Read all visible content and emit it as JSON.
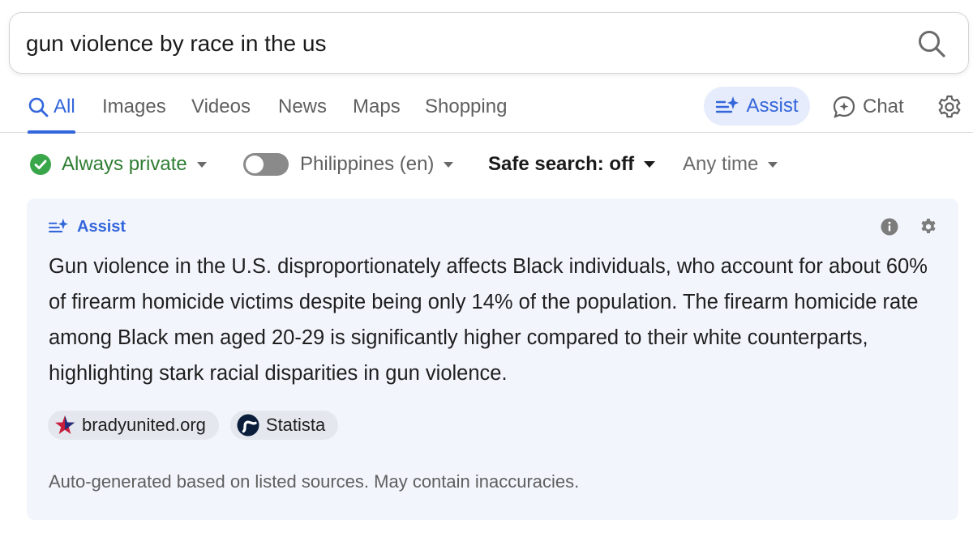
{
  "search": {
    "query": "gun violence by race in the us"
  },
  "tabs": [
    {
      "label": "All"
    },
    {
      "label": "Images"
    },
    {
      "label": "Videos"
    },
    {
      "label": "News"
    },
    {
      "label": "Maps"
    },
    {
      "label": "Shopping"
    }
  ],
  "assist_tab": {
    "label": "Assist"
  },
  "chat_tab": {
    "label": "Chat"
  },
  "filters": {
    "privacy": "Always private",
    "region": "Philippines (en)",
    "safe_search": "Safe search: off",
    "time": "Any time"
  },
  "assist_card": {
    "title": "Assist",
    "answer": "Gun violence in the U.S. disproportionately affects Black individuals, who account for about 60% of firearm homicide victims despite being only 14% of the population. The firearm homicide rate among Black men aged 20-29 is significantly higher compared to their white counterparts, highlighting stark racial disparities in gun violence.",
    "sources": [
      {
        "name": "bradyunited.org",
        "icon": "brady-star-icon"
      },
      {
        "name": "Statista",
        "icon": "statista-icon"
      }
    ],
    "disclaimer": "Auto-generated based on listed sources. May contain inaccuracies."
  },
  "colors": {
    "accent": "#3466db",
    "private_green": "#2f7d32",
    "card_bg": "#f2f5fc"
  }
}
